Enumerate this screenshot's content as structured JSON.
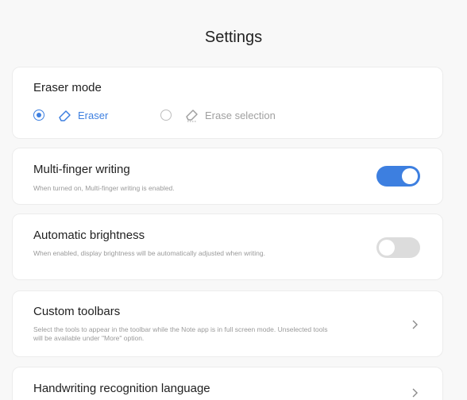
{
  "header": {
    "title": "Settings"
  },
  "eraser_mode": {
    "title": "Eraser mode",
    "options": [
      {
        "label": "Eraser",
        "selected": true,
        "icon": "eraser-icon"
      },
      {
        "label": "Erase selection",
        "selected": false,
        "icon": "erase-selection-icon"
      }
    ]
  },
  "multi_finger": {
    "title": "Multi-finger writing",
    "description": "When turned on, Multi-finger writing is enabled.",
    "enabled": true
  },
  "brightness": {
    "title": "Automatic brightness",
    "description": "When enabled, display brightness will be automatically adjusted when writing.",
    "enabled": false
  },
  "toolbars": {
    "title": "Custom toolbars",
    "description": "Select the tools to appear in the toolbar while the Note app is in full screen mode. Unselected tools will be available under \"More\" option."
  },
  "handwriting": {
    "title": "Handwriting recognition language"
  },
  "colors": {
    "accent": "#3d7fe0",
    "toggle_off": "#dcdcdc",
    "muted": "#9a9a9a"
  }
}
